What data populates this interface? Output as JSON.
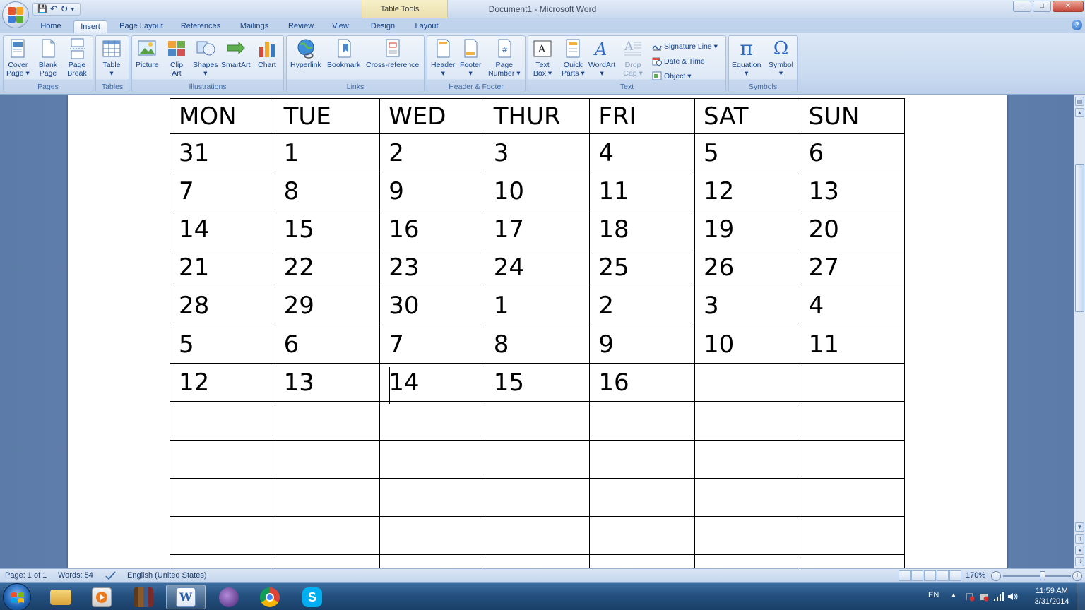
{
  "window": {
    "title": "Document1 - Microsoft Word",
    "contextual_tab": "Table Tools",
    "controls": {
      "minimize": "–",
      "maximize": "□",
      "close": "✕"
    }
  },
  "qat": {
    "save": "💾",
    "undo": "↶",
    "redo": "↻",
    "customize": "▾"
  },
  "tabs": [
    {
      "label": "Home",
      "active": false
    },
    {
      "label": "Insert",
      "active": true
    },
    {
      "label": "Page Layout",
      "active": false
    },
    {
      "label": "References",
      "active": false
    },
    {
      "label": "Mailings",
      "active": false
    },
    {
      "label": "Review",
      "active": false
    },
    {
      "label": "View",
      "active": false
    },
    {
      "label": "Design",
      "active": false
    },
    {
      "label": "Layout",
      "active": false
    }
  ],
  "help": "?",
  "ribbon": {
    "pages": {
      "label": "Pages",
      "cover": "Cover Page ▾",
      "cover_line1": "Cover",
      "cover_line2": "Page ▾",
      "blank_line1": "Blank",
      "blank_line2": "Page",
      "break_line1": "Page",
      "break_line2": "Break"
    },
    "tables": {
      "label": "Tables",
      "table": "Table",
      "table_arrow": "▾"
    },
    "illustrations": {
      "label": "Illustrations",
      "picture": "Picture",
      "clip_line1": "Clip",
      "clip_line2": "Art",
      "shapes": "Shapes",
      "shapes_arrow": "▾",
      "smartart": "SmartArt",
      "chart": "Chart"
    },
    "links": {
      "label": "Links",
      "hyperlink": "Hyperlink",
      "bookmark": "Bookmark",
      "crossref": "Cross-reference"
    },
    "header_footer": {
      "label": "Header & Footer",
      "header": "Header",
      "header_arrow": "▾",
      "footer": "Footer",
      "footer_arrow": "▾",
      "pagenum_line1": "Page",
      "pagenum_line2": "Number ▾"
    },
    "text": {
      "label": "Text",
      "textbox_line1": "Text",
      "textbox_line2": "Box ▾",
      "quick_line1": "Quick",
      "quick_line2": "Parts ▾",
      "wordart": "WordArt",
      "wordart_arrow": "▾",
      "dropcap_line1": "Drop",
      "dropcap_line2": "Cap ▾",
      "signature": "Signature Line ▾",
      "datetime": "Date & Time",
      "object": "Object ▾"
    },
    "symbols": {
      "label": "Symbols",
      "equation": "Equation",
      "equation_arrow": "▾",
      "symbol": "Symbol",
      "symbol_arrow": "▾",
      "pi": "π",
      "omega": "Ω"
    }
  },
  "calendar": {
    "headers": [
      "MON",
      "TUE",
      "WED",
      "THUR",
      "FRI",
      "SAT",
      "SUN"
    ],
    "rows": [
      [
        "31",
        "1",
        "2",
        "3",
        "4",
        "5",
        "6"
      ],
      [
        "7",
        "8",
        "9",
        "10",
        "11",
        "12",
        "13"
      ],
      [
        "14",
        "15",
        "16",
        "17",
        "18",
        "19",
        "20"
      ],
      [
        "21",
        "22",
        "23",
        "24",
        "25",
        "26",
        "27"
      ],
      [
        "28",
        "29",
        "30",
        "1",
        "2",
        "3",
        "4"
      ],
      [
        "5",
        "6",
        "7",
        "8",
        "9",
        "10",
        "11"
      ],
      [
        "12",
        "13",
        "14",
        "15",
        "16",
        "",
        ""
      ],
      [
        "",
        "",
        "",
        "",
        "",
        "",
        ""
      ],
      [
        "",
        "",
        "",
        "",
        "",
        "",
        ""
      ],
      [
        "",
        "",
        "",
        "",
        "",
        "",
        ""
      ],
      [
        "",
        "",
        "",
        "",
        "",
        "",
        ""
      ],
      [
        "",
        "",
        "",
        "",
        "",
        "",
        ""
      ]
    ]
  },
  "status": {
    "page": "Page: 1 of 1",
    "words": "Words: 54",
    "language": "English (United States)",
    "zoom": "170%",
    "zoom_level_percent": 170
  },
  "taskbar": {
    "lang": "EN",
    "time": "11:59 AM",
    "date": "3/31/2014",
    "tray_arrow": "▲"
  }
}
